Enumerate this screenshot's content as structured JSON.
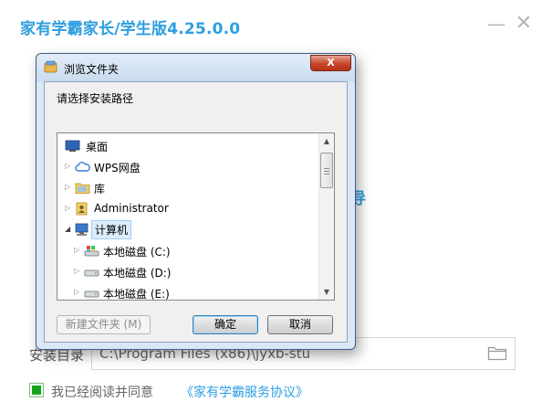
{
  "app": {
    "title": "家有学霸家长/学生版4.25.0.0",
    "minimize_glyph": "—",
    "close_glyph": "✕",
    "background_peek_char": "导"
  },
  "install": {
    "label": "安装目录",
    "path": "C:\\Program Files (x86)\\jyxb-stu",
    "folder_icon": "folder-icon"
  },
  "agreement": {
    "checked": true,
    "text": "我已经阅读并同意",
    "link": "《家有学霸服务协议》"
  },
  "dialog": {
    "title": "浏览文件夹",
    "close_glyph": "X",
    "prompt": "请选择安装路径",
    "tree": [
      {
        "label": "桌面",
        "icon": "desktop-icon",
        "toggle": "",
        "selected": false
      },
      {
        "label": "WPS网盘",
        "icon": "cloud-icon",
        "toggle": "▷",
        "selected": false
      },
      {
        "label": "库",
        "icon": "library-icon",
        "toggle": "▷",
        "selected": false
      },
      {
        "label": "Administrator",
        "icon": "user-folder-icon",
        "toggle": "▷",
        "selected": false
      },
      {
        "label": "计算机",
        "icon": "computer-icon",
        "toggle": "◢",
        "selected": true
      },
      {
        "label": "本地磁盘 (C:)",
        "icon": "system-drive-icon",
        "toggle": "▷",
        "selected": false
      },
      {
        "label": "本地磁盘 (D:)",
        "icon": "drive-icon",
        "toggle": "▷",
        "selected": false
      },
      {
        "label": "本地磁盘 (E:)",
        "icon": "drive-icon",
        "toggle": "▷",
        "selected": false
      }
    ],
    "scroll_up_glyph": "▲",
    "scroll_down_glyph": "▼",
    "buttons": {
      "new_folder": "新建文件夹 (M)",
      "ok": "确定",
      "cancel": "取消"
    }
  },
  "colors": {
    "accent": "#2d9ee0",
    "checkbox_fill": "#16a51a",
    "dialog_close": "#c8452a"
  }
}
